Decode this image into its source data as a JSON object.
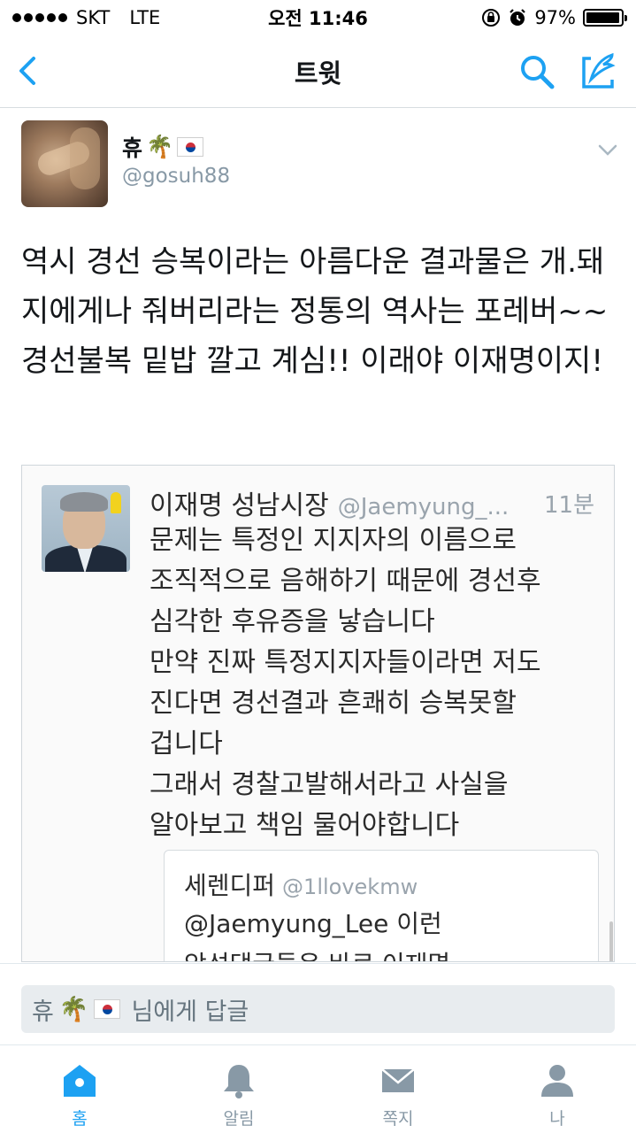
{
  "status_bar": {
    "carrier": "SKT",
    "network": "LTE",
    "time": "오전 11:46",
    "battery": "97%",
    "battery_level": 0.97
  },
  "nav": {
    "title": "트윗",
    "back_icon": "chevron-left-icon",
    "search_icon": "search-icon",
    "compose_icon": "compose-icon",
    "accent_color": "#1da1f2"
  },
  "tweet": {
    "user_name": "휴",
    "user_emoji": "🌴",
    "handle": "@gosuh88",
    "text": "역시 경선 승복이라는 아름다운 결과물은 개.돼지에게나 줘버리라는 정통의 역사는 포레버~~ 경선불복 밑밥 깔고 계심!! 이래야 이재명이지!"
  },
  "embed": {
    "name": "이재명 성남시장",
    "handle": "@Jaemyung_...",
    "time": "11분",
    "body": "문제는 특정인 지지자의 이름으로\n조직적으로 음해하기 때문에 경선후\n심각한 후유증을 낳습니다\n만약 진짜 특정지지자들이라면 저도\n진다면 경선결과 흔쾌히 승복못할\n겁니다\n그래서 경찰고발해서라고 사실을\n알아보고 책임 물어야합니다",
    "quote": {
      "name": "세렌디퍼",
      "handle": "@1llovekmw",
      "text": "@Jaemyung_Lee  이런\n악성댓글들은 바로 이재명"
    }
  },
  "reply": {
    "name": "휴",
    "emoji": "🌴",
    "placeholder_suffix": "님에게 답글"
  },
  "tabs": [
    {
      "label": "홈",
      "icon": "home-icon",
      "active": true
    },
    {
      "label": "알림",
      "icon": "bell-icon",
      "active": false
    },
    {
      "label": "쪽지",
      "icon": "envelope-icon",
      "active": false
    },
    {
      "label": "나",
      "icon": "person-icon",
      "active": false
    }
  ]
}
